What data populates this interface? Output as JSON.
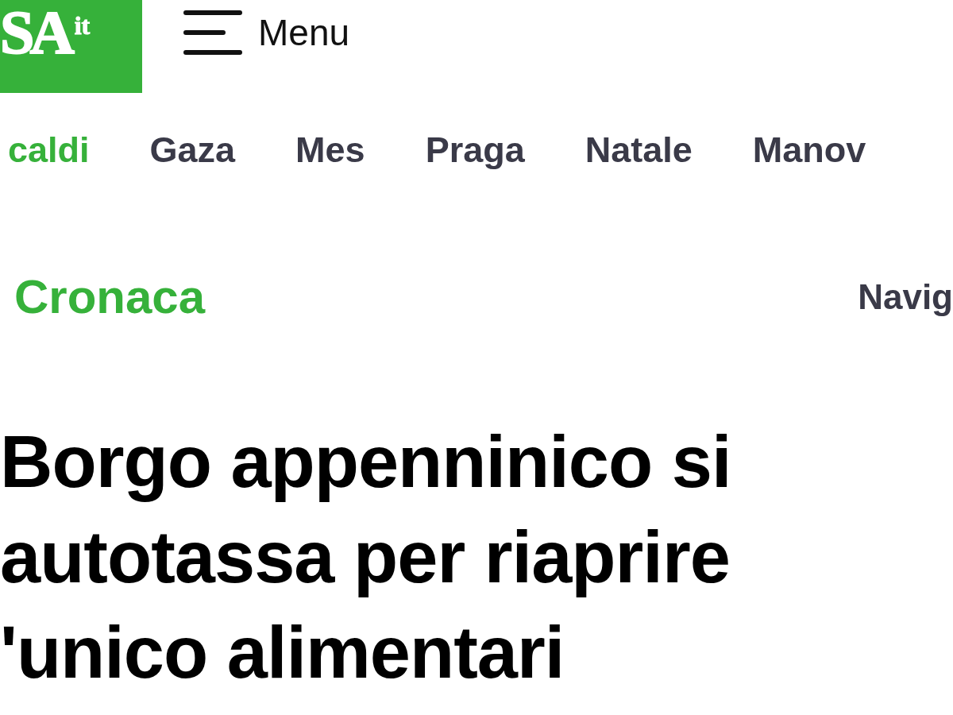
{
  "header": {
    "logo": {
      "main": "SA",
      "suffix": "it"
    },
    "menu": {
      "label": "Menu"
    }
  },
  "topics": [
    {
      "label": "caldi",
      "kind": "heading"
    },
    {
      "label": "Gaza",
      "kind": "topic"
    },
    {
      "label": "Mes",
      "kind": "topic"
    },
    {
      "label": "Praga",
      "kind": "topic"
    },
    {
      "label": "Natale",
      "kind": "topic"
    },
    {
      "label": "Manov",
      "kind": "topic"
    }
  ],
  "breadcrumb": {
    "section": "Cronaca",
    "navigation": "Navig"
  },
  "headline": {
    "lines": [
      "Borgo appenninico si",
      "autotassa per riaprire",
      "'unico alimentari"
    ]
  }
}
